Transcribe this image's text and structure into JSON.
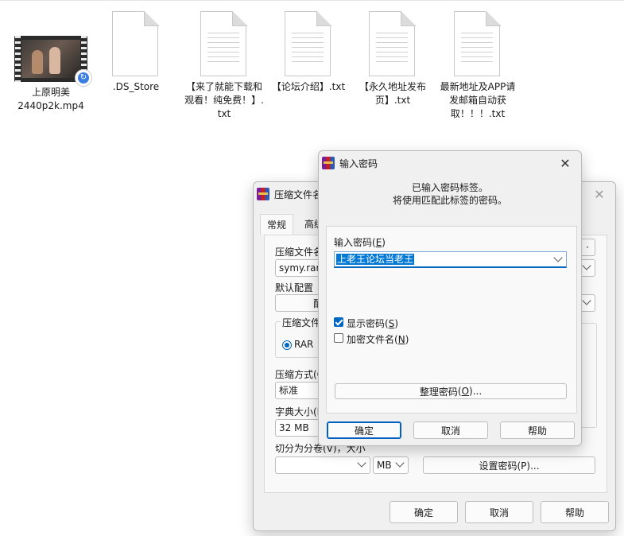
{
  "files": [
    {
      "name": "上原明美\n2440p2k.mp4",
      "icon": "video-file-icon"
    },
    {
      "name": ".DS_Store",
      "icon": "file-icon"
    },
    {
      "name": "【来了就能下载和观看！纯免费！】.txt",
      "icon": "text-file-icon"
    },
    {
      "name": "【论坛介绍】.txt",
      "icon": "text-file-icon"
    },
    {
      "name": "【永久地址发布页】.txt",
      "icon": "text-file-icon"
    },
    {
      "name": "最新地址及APP请发邮箱自动获取！！！.txt",
      "icon": "text-file-icon"
    }
  ],
  "archive_dialog": {
    "title": "压缩文件名",
    "tabs": [
      "常规",
      "高级"
    ],
    "archive_name_label": "压缩文件名",
    "archive_name_value": "symy.rar",
    "profile_label": "默认配置",
    "profile_button_partial": "配",
    "format_group_label": "压缩文件",
    "format_option": "RAR",
    "method_label": "压缩方式(C",
    "method_value": "标准",
    "dict_label": "字典大小(I",
    "dict_value": "32 MB",
    "split_label": "切分为分卷(V)，大小",
    "split_unit": "MB",
    "set_password_button": "设置密码(P)...",
    "ok_button": "确定",
    "cancel_button": "取消",
    "help_button": "帮助"
  },
  "password_dialog": {
    "title": "输入密码",
    "info_line1": "已输入密码标签。",
    "info_line2": "将使用匹配此标签的密码。",
    "password_label": "输入密码",
    "password_label_key": "E",
    "password_value": "上老王论坛当老王",
    "show_password_label": "显示密码",
    "show_password_key": "S",
    "show_password_checked": true,
    "encrypt_names_label": "加密文件名",
    "encrypt_names_key": "N",
    "encrypt_names_checked": false,
    "organize_button": "整理密码",
    "organize_key": "O",
    "ok_button": "确定",
    "cancel_button": "取消",
    "help_button": "帮助"
  }
}
